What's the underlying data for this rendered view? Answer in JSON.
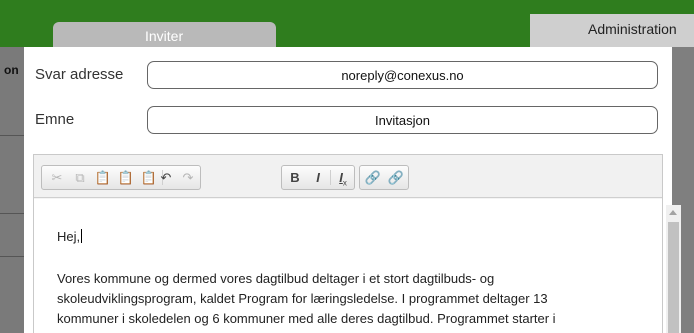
{
  "background": {
    "admin_tab_label": "Administration",
    "left_fragment": "on"
  },
  "modal": {
    "tab_label": "Inviter",
    "reply_label": "Svar adresse",
    "reply_value": "noreply@conexus.no",
    "subject_label": "Emne",
    "subject_value": "Invitasjon"
  },
  "toolbar": {
    "bold_label": "B",
    "italic_label": "I",
    "clear_format_label": "I"
  },
  "editor": {
    "greeting": "Hej,",
    "line1": "Vores kommune og dermed vores dagtilbud deltager i et stort dagtilbuds- og",
    "line2": "skoleudviklingsprogram, kaldet Program for læringsledelse. I programmet deltager 13",
    "line3": "kommuner i skoledelen og 6 kommuner med alle deres dagtilbud. Programmet starter i"
  },
  "colors": {
    "header_green": "#2f7d1e",
    "tab_gray": "#b9b9b9"
  }
}
